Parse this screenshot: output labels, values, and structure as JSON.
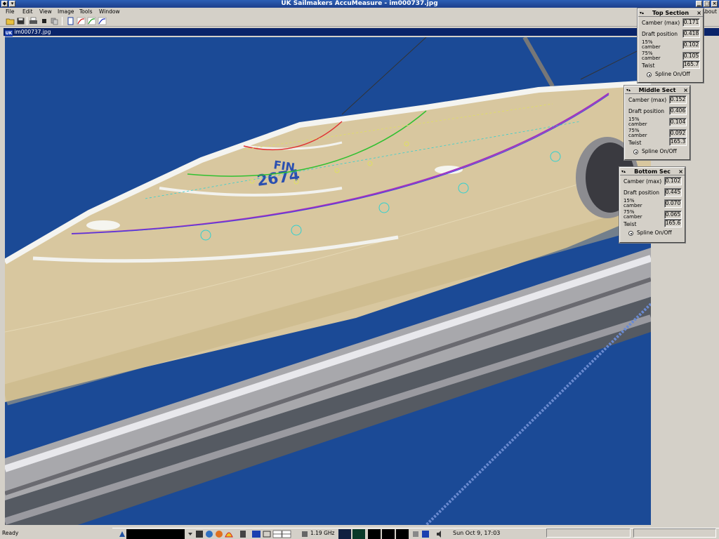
{
  "window": {
    "title": "UK Sailmakers AccuMeasure - im000737.jpg"
  },
  "menu": {
    "items": [
      "File",
      "Edit",
      "View",
      "Image",
      "Tools",
      "Window"
    ],
    "about": "About"
  },
  "document": {
    "title": "im000737.jpg",
    "logo": "UK"
  },
  "panels": {
    "top": {
      "title": "Top Section",
      "camber_label": "Camber (max)",
      "camber": "0.171",
      "draft_label": "Draft position",
      "draft": "0.418",
      "c15_label": "15% camber",
      "c15": "0.102",
      "c75_label": "75% camber",
      "c75": "0.105",
      "twist_label": "Twist",
      "twist": "165.7",
      "spline_label": "Spline On/Off"
    },
    "middle": {
      "title": "Middle Sect",
      "camber_label": "Camber (max)",
      "camber": "0.152",
      "draft_label": "Draft position",
      "draft": "0.406",
      "c15_label": "15% camber",
      "c15": "0.104",
      "c75_label": "75% camber",
      "c75": "0.092",
      "twist_label": "Twist",
      "twist": "165.3",
      "spline_label": "Spline On/Off"
    },
    "bottom": {
      "title": "Bottom Sec",
      "camber_label": "Camber (max)",
      "camber": "0.102",
      "draft_label": "Draft position",
      "draft": "0.445",
      "c15_label": "15% camber",
      "c15": "0.070",
      "c75_label": "75% camber",
      "c75": "0.065",
      "twist_label": "Twist",
      "twist": "165.6",
      "spline_label": "Spline On/Off"
    }
  },
  "sail": {
    "text1": "FIN",
    "text2": "2674"
  },
  "status": {
    "text": "Ready"
  },
  "taskbar": {
    "cpu": "1.19 GHz",
    "clock": "Sun Oct  9, 17:03"
  },
  "colors": {
    "sky": "#1b4a96",
    "sail": "#d8c79f",
    "top_line": "#e03030",
    "mid_line": "#30c030",
    "bot_line": "#a030c0",
    "guide": "#30d0d0"
  }
}
